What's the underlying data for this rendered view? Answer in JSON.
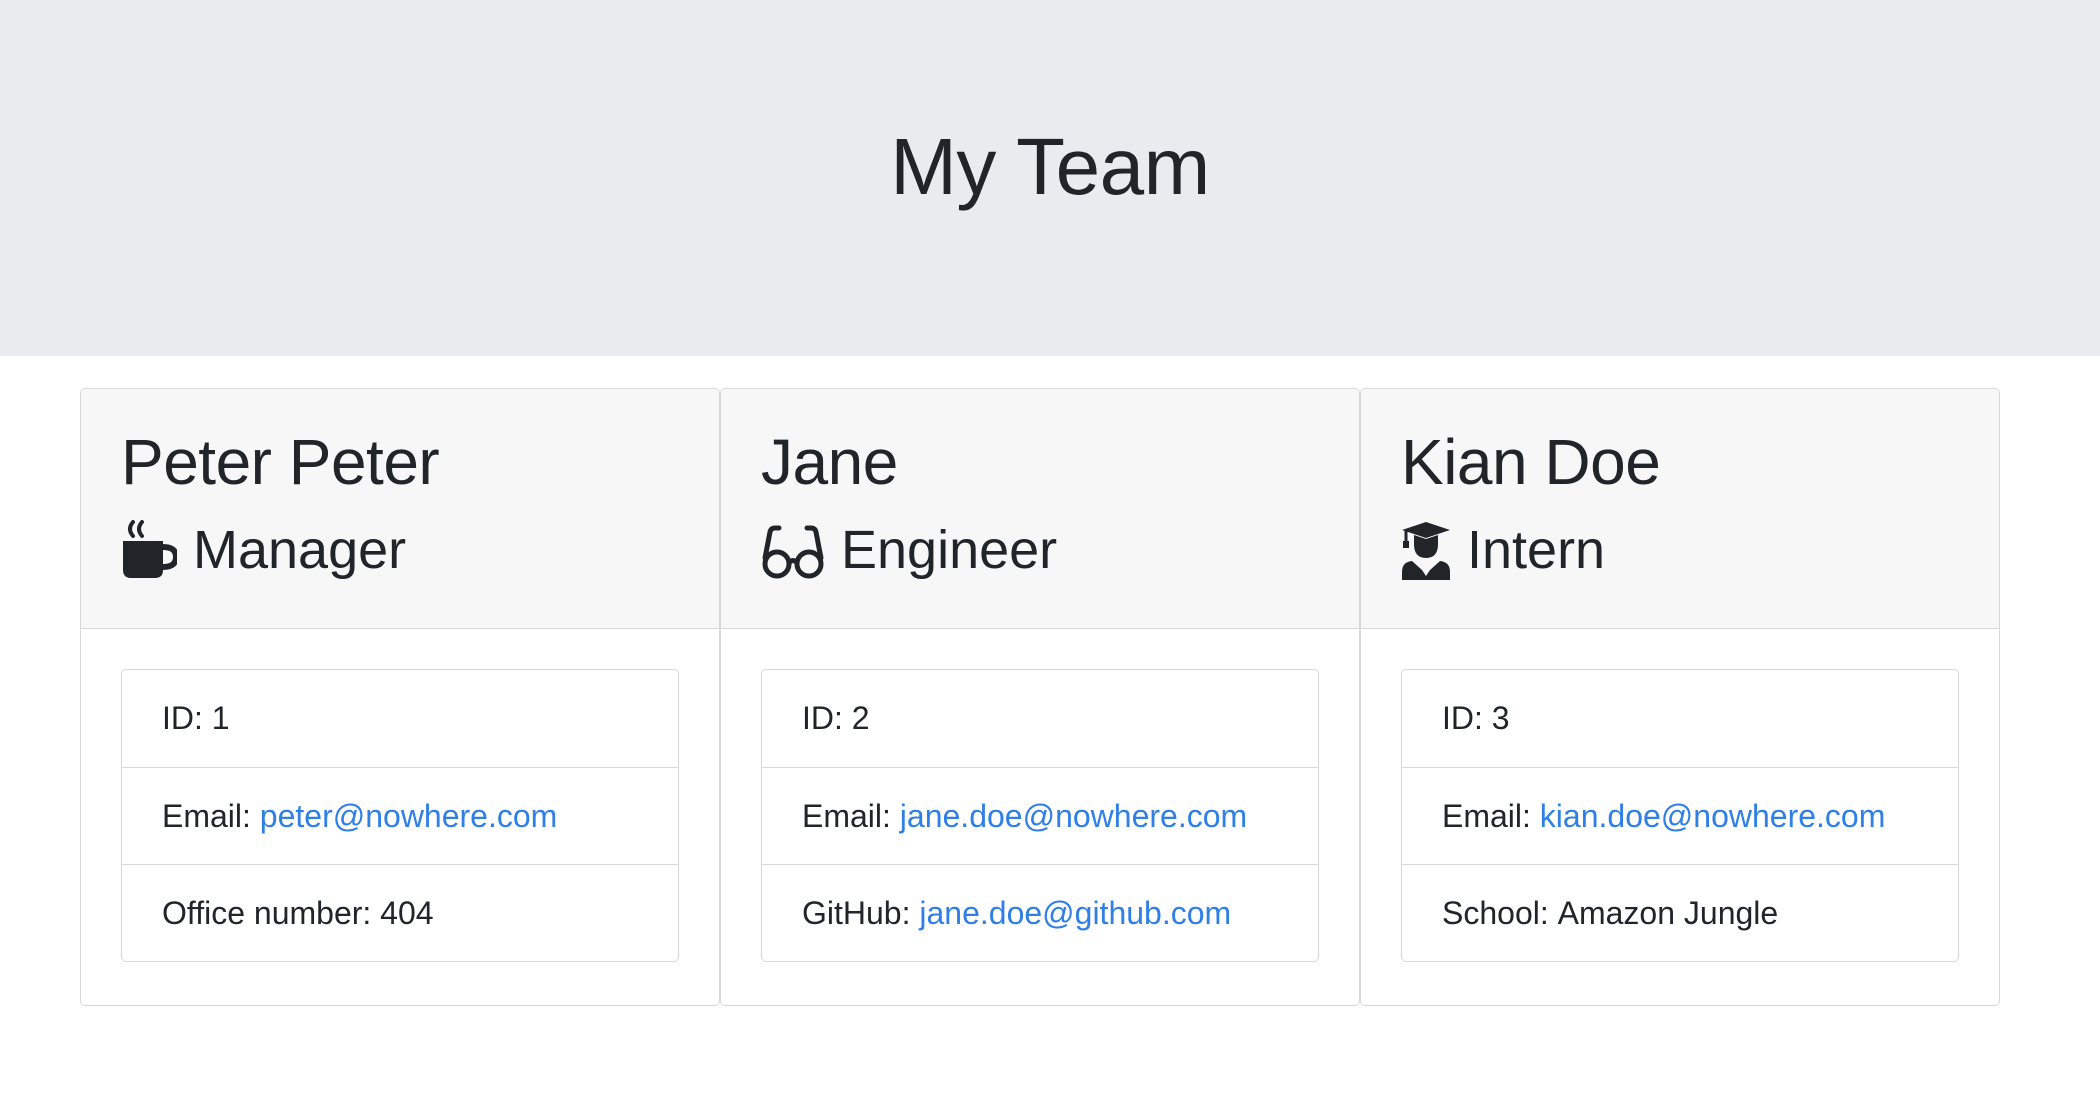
{
  "header": {
    "title": "My Team"
  },
  "employees": [
    {
      "name": "Peter Peter",
      "role": "Manager",
      "icon": "coffee-icon",
      "details": [
        {
          "label": "ID: ",
          "value": "1"
        },
        {
          "label": "Email: ",
          "value": "peter@nowhere.com"
        },
        {
          "label": "Office number: ",
          "value": "404"
        }
      ]
    },
    {
      "name": "Jane",
      "role": "Engineer",
      "icon": "glasses-icon",
      "details": [
        {
          "label": "ID: ",
          "value": "2"
        },
        {
          "label": "Email: ",
          "value": "jane.doe@nowhere.com"
        },
        {
          "label": "GitHub: ",
          "value": "jane.doe@github.com"
        }
      ]
    },
    {
      "name": "Kian Doe",
      "role": "Intern",
      "icon": "user-graduate-icon",
      "details": [
        {
          "label": "ID: ",
          "value": "3"
        },
        {
          "label": "Email: ",
          "value": "kian.doe@nowhere.com"
        },
        {
          "label": "School: ",
          "value": "Amazon Jungle"
        }
      ]
    }
  ],
  "colors": {
    "link": "#2f7fe6",
    "header_bg": "#e9ecef",
    "card_header_bg": "#f7f7f7"
  }
}
